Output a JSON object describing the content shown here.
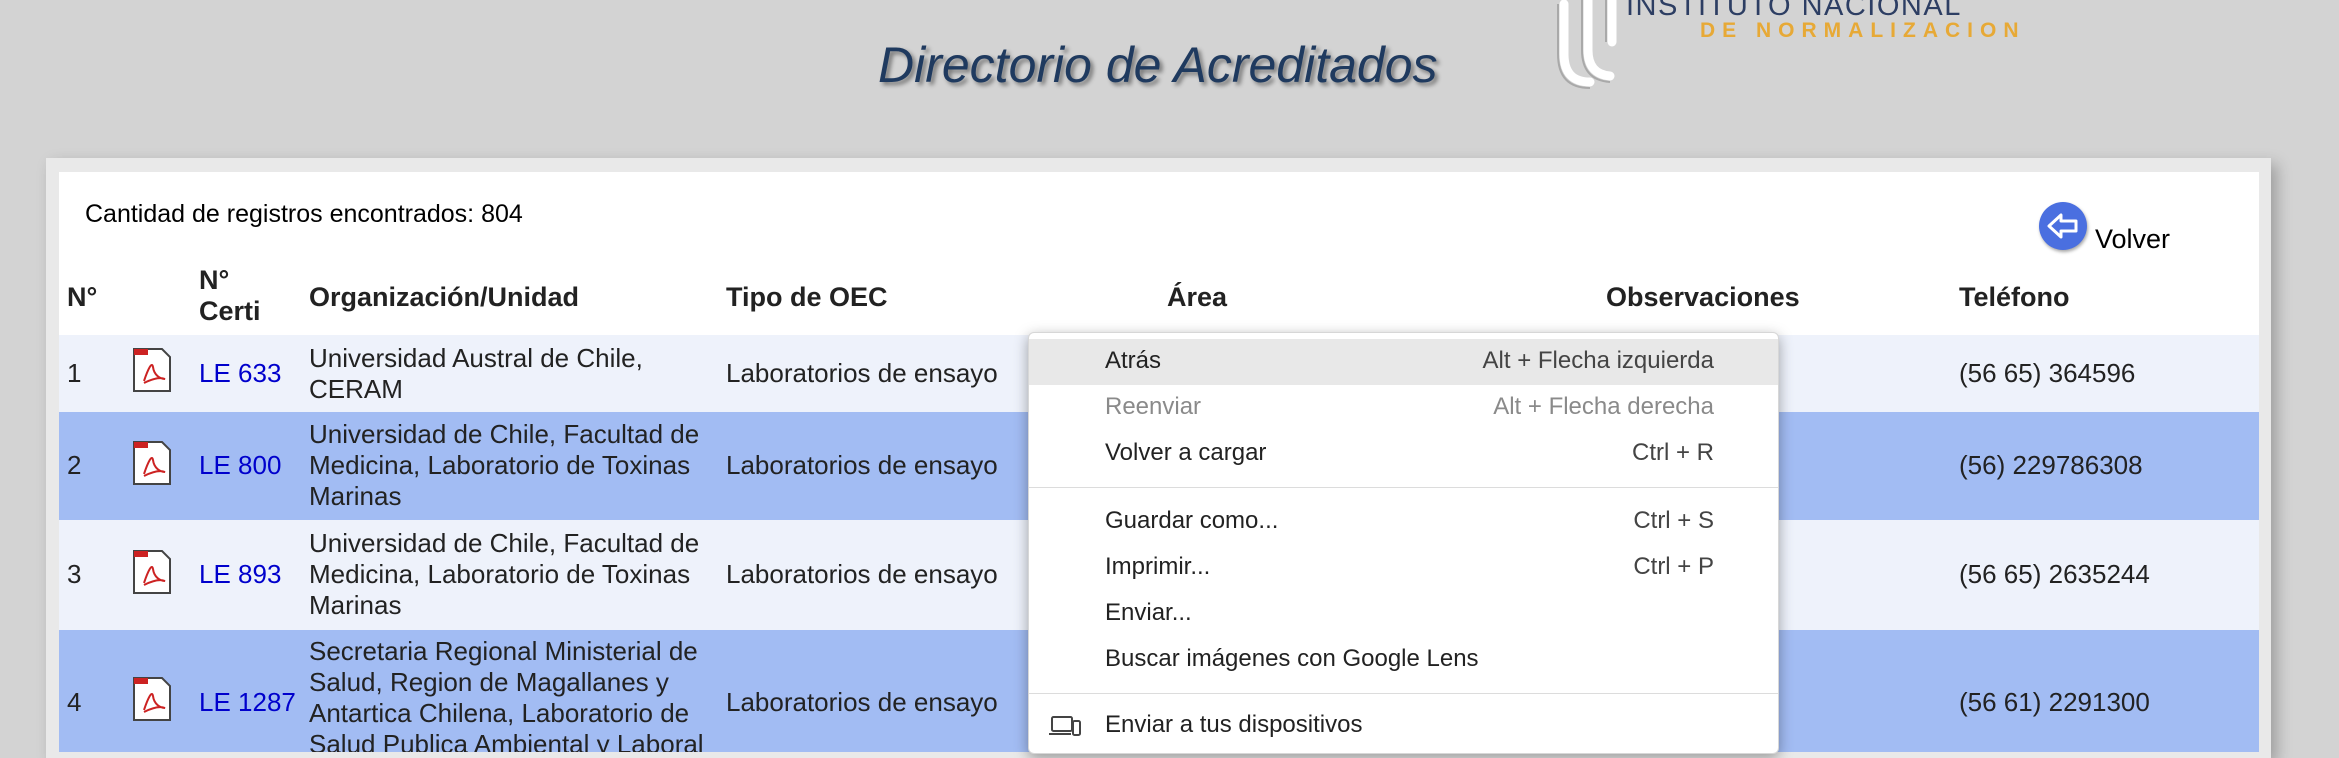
{
  "page": {
    "title": "Directorio de Acreditados"
  },
  "logo": {
    "line1": "INSTITUTO NACIONAL",
    "line2": "DE NORMALIZACION"
  },
  "record_count": "Cantidad de registros encontrados: 804",
  "back_button": {
    "label": "Volver",
    "icon": "back-arrow-icon"
  },
  "table": {
    "headers": {
      "num": "N°",
      "cert_line1": "N°",
      "cert_line2": "Certi",
      "org": "Organización/Unidad",
      "tipo": "Tipo de OEC",
      "area": "Área",
      "obs": "Observaciones",
      "tel": "Teléfono"
    },
    "rows": [
      {
        "num": "1",
        "cert": "LE 633",
        "org": "Universidad Austral de Chile, CERAM",
        "tipo": "Laboratorios de ensayo",
        "tel": "(56 65) 364596"
      },
      {
        "num": "2",
        "cert": "LE 800",
        "org": "Universidad de Chile, Facultad de Medicina, Laboratorio de Toxinas Marinas",
        "tipo": "Laboratorios de ensayo",
        "tel": "(56) 229786308"
      },
      {
        "num": "3",
        "cert": "LE 893",
        "org": "Universidad de Chile, Facultad de Medicina, Laboratorio de Toxinas Marinas",
        "tipo": "Laboratorios de ensayo",
        "tel": "(56 65) 2635244"
      },
      {
        "num": "4",
        "cert": "LE 1287",
        "org": "Secretaria Regional Ministerial de Salud, Region de Magallanes y Antartica Chilena, Laboratorio de Salud Publica Ambiental y Laboral",
        "tipo": "Laboratorios de ensayo",
        "tel": "(56 61) 2291300"
      }
    ]
  },
  "context_menu": {
    "items": [
      {
        "label": "Atrás",
        "shortcut": "Alt + Flecha izquierda",
        "state": "hover"
      },
      {
        "label": "Reenviar",
        "shortcut": "Alt + Flecha derecha",
        "state": "disabled"
      },
      {
        "label": "Volver a cargar",
        "shortcut": "Ctrl + R",
        "state": "normal"
      },
      {
        "label": "Guardar como...",
        "shortcut": "Ctrl + S",
        "state": "normal"
      },
      {
        "label": "Imprimir...",
        "shortcut": "Ctrl + P",
        "state": "normal"
      },
      {
        "label": "Enviar...",
        "shortcut": "",
        "state": "normal"
      },
      {
        "label": "Buscar imágenes con Google Lens",
        "shortcut": "",
        "state": "normal"
      },
      {
        "label": "Enviar a tus dispositivos",
        "shortcut": "",
        "state": "normal",
        "icon": "devices-icon"
      }
    ]
  },
  "colors": {
    "row_light": "#eef2fb",
    "row_blue": "#a2bcf3",
    "link": "#0000cc",
    "title": "#1f3a5f",
    "logo_accent": "#e7a936"
  }
}
